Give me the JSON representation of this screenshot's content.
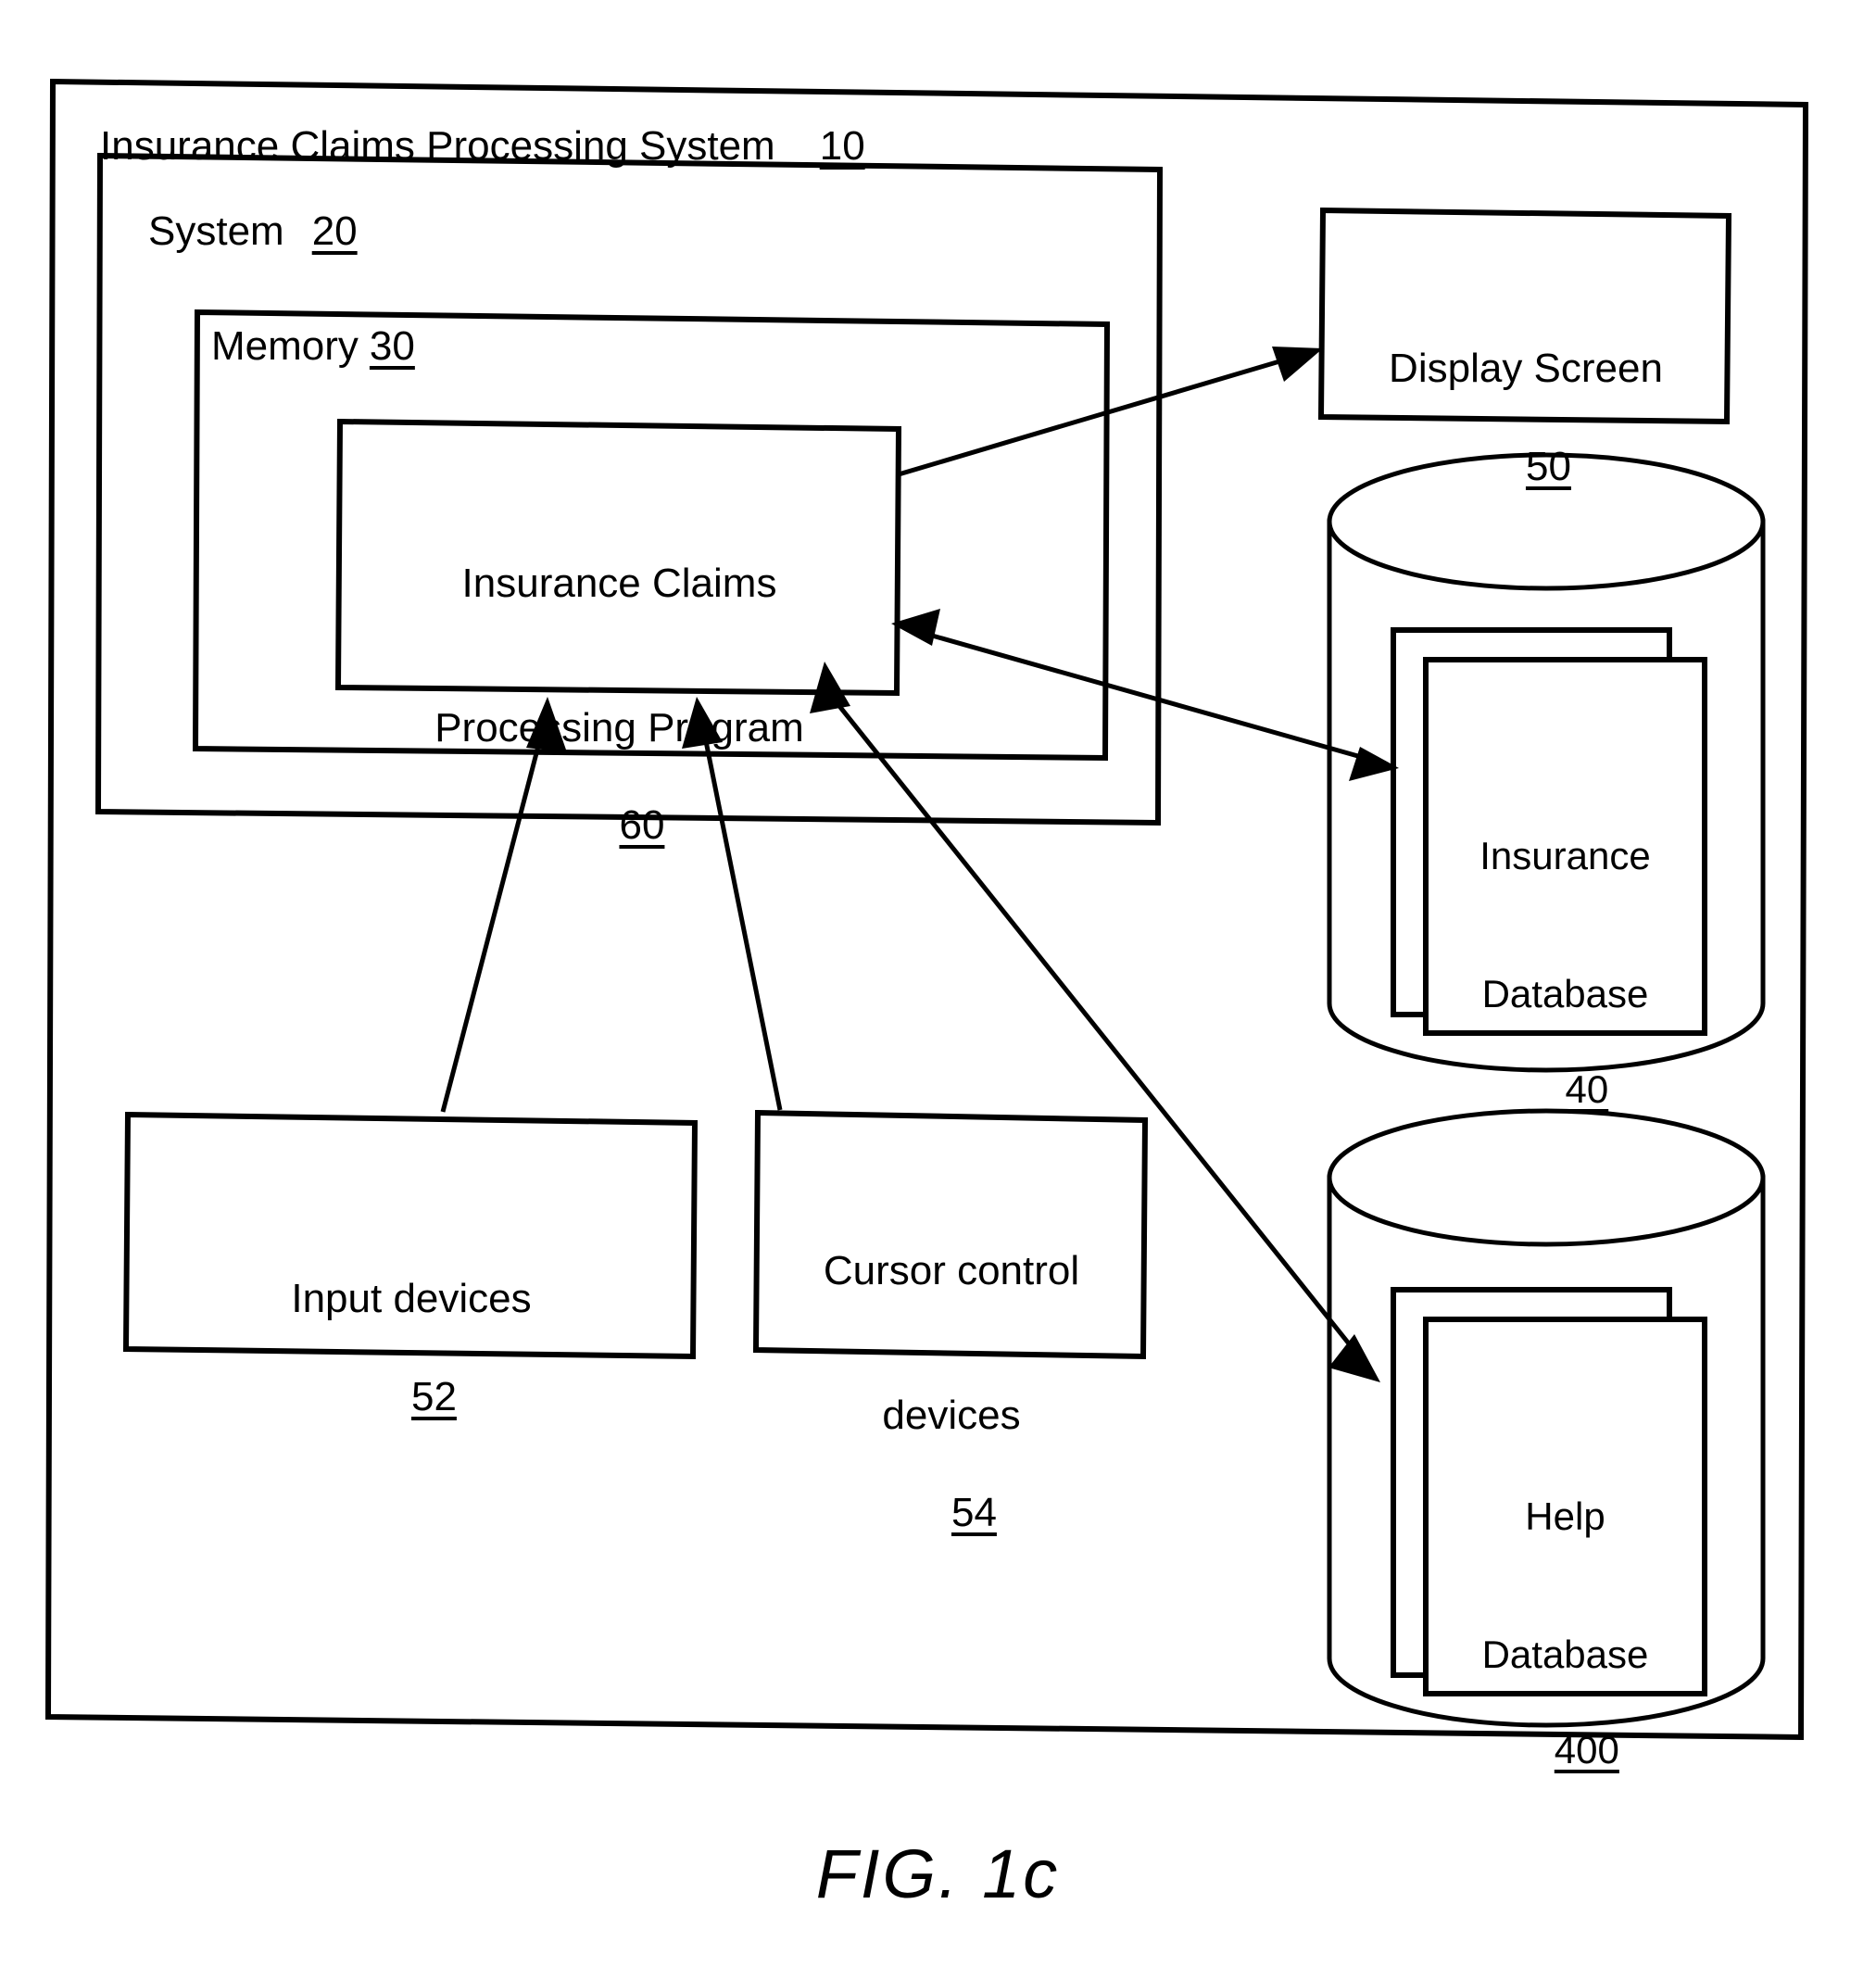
{
  "figure": {
    "caption": "FIG. 1c"
  },
  "outer_system": {
    "label": "Insurance Claims Processing System",
    "ref": "10"
  },
  "system_box": {
    "label": "System",
    "ref": "20"
  },
  "memory_box": {
    "label": "Memory",
    "ref": "30"
  },
  "program_box": {
    "line1": "Insurance Claims",
    "line2": "Processing Program",
    "ref": "60"
  },
  "display_screen": {
    "label": "Display Screen",
    "ref": "50"
  },
  "insurance_database": {
    "line1": "Insurance",
    "line2": "Database",
    "ref": "40"
  },
  "help_database": {
    "line1": "Help",
    "line2": "Database",
    "ref": "400"
  },
  "input_devices": {
    "label": "Input devices",
    "ref": "52"
  },
  "cursor_control_devices": {
    "line1": "Cursor control",
    "line2": "devices",
    "ref": "54"
  },
  "connections": [
    {
      "name": "program-to-display-screen",
      "from": "Insurance Claims Processing Program 60",
      "to": "Display Screen 50",
      "direction": "one-way"
    },
    {
      "name": "insurance-database-to-program",
      "from": "Insurance Database 40",
      "to": "Insurance Claims Processing Program 60",
      "direction": "bidirectional"
    },
    {
      "name": "input-devices-to-program",
      "from": "Input devices 52",
      "to": "Insurance Claims Processing Program 60",
      "direction": "one-way"
    },
    {
      "name": "cursor-control-to-program",
      "from": "Cursor control devices 54",
      "to": "Insurance Claims Processing Program 60",
      "direction": "one-way"
    },
    {
      "name": "program-to-help-database",
      "from": "Insurance Claims Processing Program 60",
      "to": "Help Database 400",
      "direction": "one-way"
    }
  ],
  "colors": {
    "stroke": "#000000",
    "background": "#ffffff"
  }
}
